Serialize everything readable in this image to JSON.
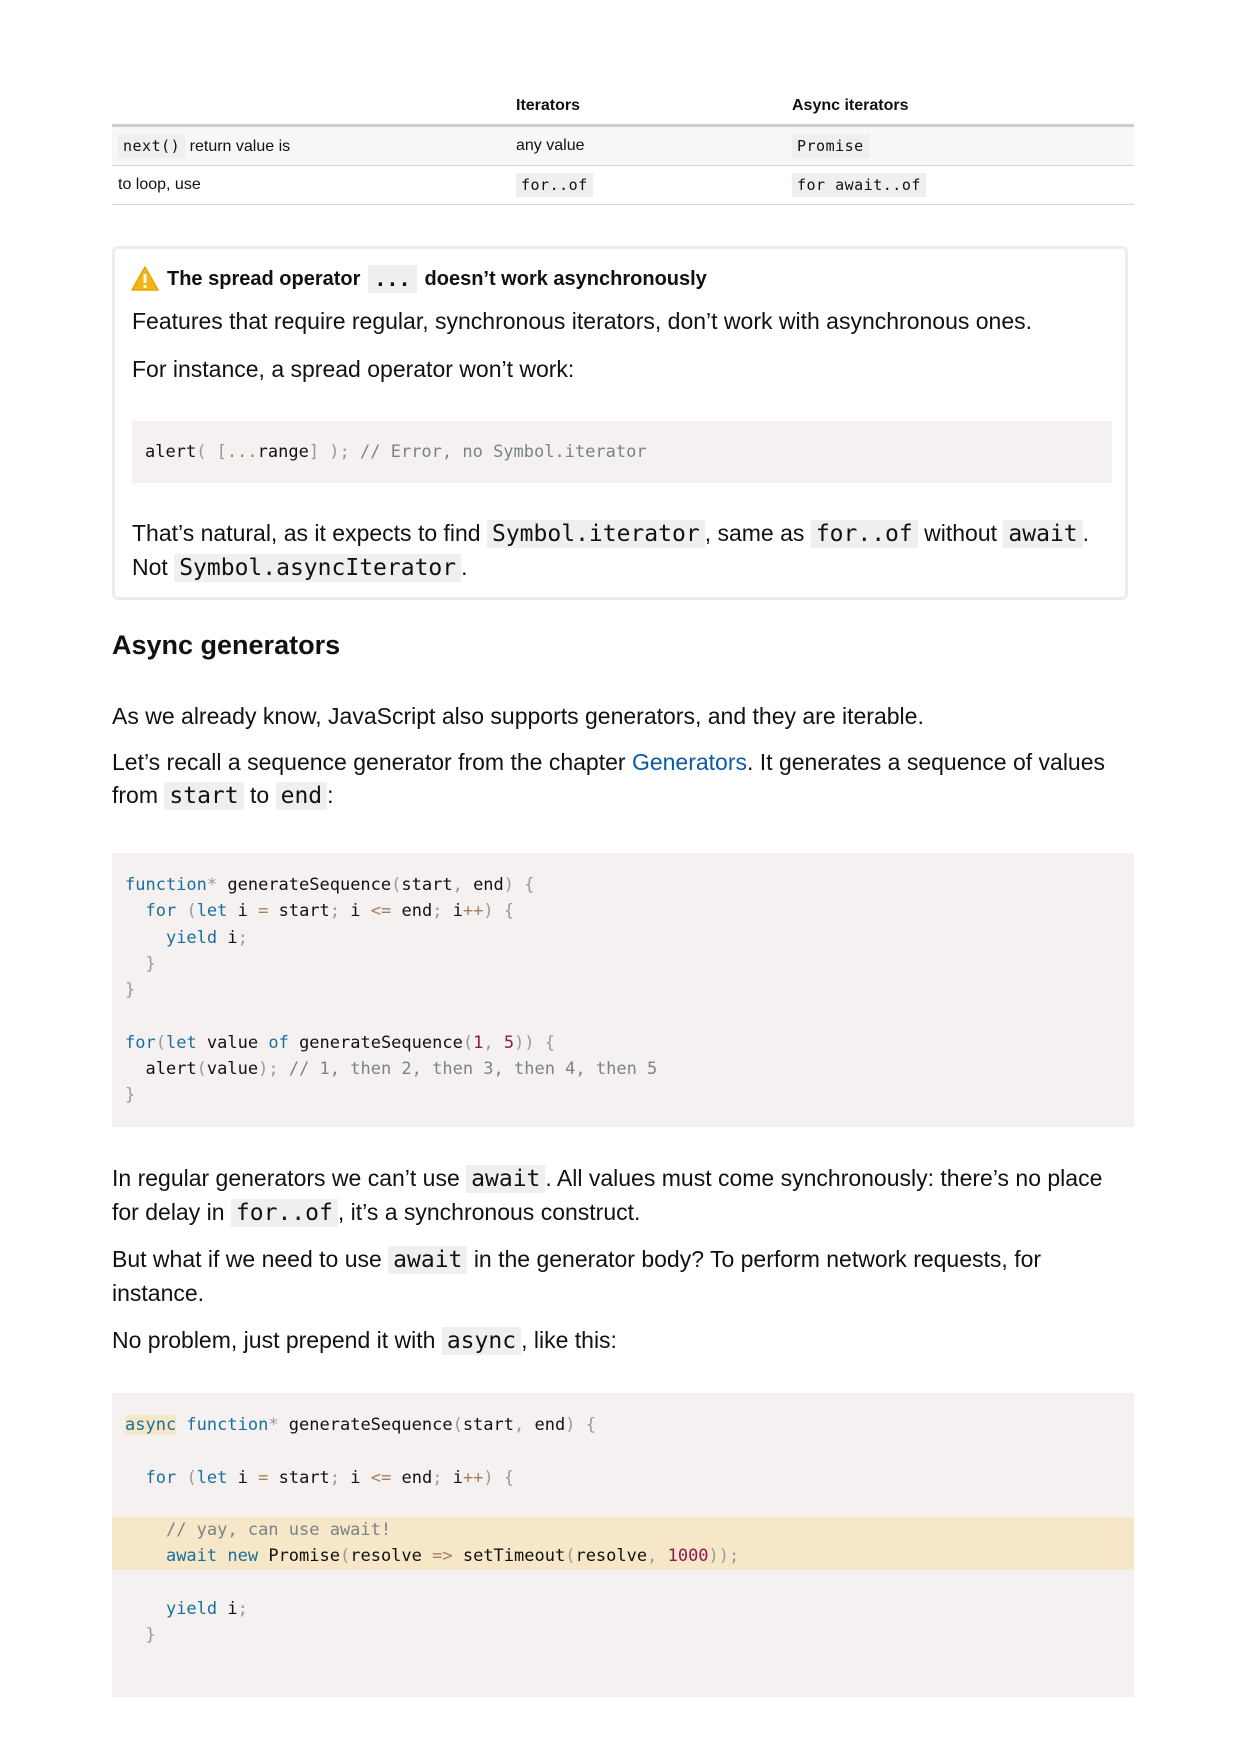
{
  "table": {
    "headers": [
      "",
      "Iterators",
      "Async iterators"
    ],
    "rows": [
      {
        "label_code": "next()",
        "label_text": "return value is",
        "iter": "any value",
        "iter_code": "",
        "async_code": "Promise"
      },
      {
        "label_code": "",
        "label_text": "to loop, use",
        "iter": "",
        "iter_code": "for..of",
        "async_code": "for await..of"
      }
    ]
  },
  "warning": {
    "title_before": "The spread operator",
    "title_code": "...",
    "title_after": "doesn’t work asynchronously",
    "p1": "Features that require regular, synchronous iterators, don’t work with asynchronous ones.",
    "p2": "For instance, a spread operator won’t work:",
    "code": {
      "fn": "alert",
      "p_open": "( [",
      "spread": "...",
      "arg": "range",
      "p_close": "] );",
      "comment": "// Error, no Symbol.iterator"
    },
    "p3": {
      "t1": "That’s natural, as it expects to find",
      "c1": "Symbol.iterator",
      "t2": ", same as",
      "c2": "for..of",
      "t3": "without",
      "c3": "await",
      "t4": ". Not",
      "c4": "Symbol.asyncIterator",
      "t5": "."
    }
  },
  "section_title": "Async generators",
  "paras": {
    "p1": "As we already know, JavaScript also supports generators, and they are iterable.",
    "p2": {
      "t1": "Let’s recall a sequence generator from the chapter",
      "link": "Generators",
      "t2": ". It generates a sequence of values from",
      "c1": "start",
      "t3": "to",
      "c2": "end",
      "t4": ":"
    },
    "p3": {
      "t1": "In regular generators we can’t use",
      "c1": "await",
      "t2": ". All values must come synchronously: there’s no place for delay in",
      "c2": "for..of",
      "t3": ", it’s a synchronous construct."
    },
    "p4": {
      "t1": "But what if we need to use",
      "c1": "await",
      "t2": "in the generator body? To perform network requests, for instance."
    },
    "p5": {
      "t1": "No problem, just prepend it with",
      "c1": "async",
      "t2": ", like this:"
    }
  },
  "code1": {
    "l1": {
      "kw": "function",
      "star": "*",
      "name": " generateSequence",
      "po": "(",
      "a1": "start",
      "comma": ",",
      "a2": " end",
      "pc": ")",
      "br": " {"
    },
    "l2": {
      "kw1": "for",
      "po": " (",
      "kw2": "let",
      "v": " i ",
      "eq": "=",
      "s": " start",
      "semi": ";",
      "i": " i ",
      "le": "<=",
      "e": " end",
      "semi2": ";",
      "ip": " i",
      "pp": "++",
      "pc": ")",
      "br": " {"
    },
    "l3": {
      "kw": "yield",
      "v": " i",
      "semi": ";"
    },
    "l4": "}",
    "l5": "}",
    "l7": {
      "kw1": "for",
      "po": "(",
      "kw2": "let",
      "v": " value ",
      "kw3": "of",
      "fn": " generateSequence",
      "po2": "(",
      "n1": "1",
      "comma": ",",
      "n2": " 5",
      "pc": "))",
      "br": " {"
    },
    "l8": {
      "fn": "alert",
      "po": "(",
      "v": "value",
      "pc": ");",
      "cm": " // 1, then 2, then 3, then 4, then 5"
    },
    "l9": "}"
  },
  "code2": {
    "l1": {
      "async": "async",
      "kw": " function",
      "star": "*",
      "name": " generateSequence",
      "po": "(",
      "a1": "start",
      "comma": ",",
      "a2": " end",
      "pc": ")",
      "br": " {"
    },
    "l3": {
      "kw1": "for",
      "po": " (",
      "kw2": "let",
      "v": " i ",
      "eq": "=",
      "s": " start",
      "semi": ";",
      "i": " i ",
      "le": "<=",
      "e": " end",
      "semi2": ";",
      "ip": " i",
      "pp": "++",
      "pc": ")",
      "br": " {"
    },
    "l5": "// yay, can use await!",
    "l6": {
      "kw1": "await",
      "kw2": " new",
      "cls": " Promise",
      "po": "(",
      "arg": "resolve ",
      "arrow": "=>",
      "fn": " setTimeout",
      "po2": "(",
      "a": "resolve",
      "comma": ",",
      "num": " 1000",
      "pc": "));"
    },
    "l8": {
      "kw": "yield",
      "v": " i",
      "semi": ";"
    },
    "l9": "}"
  },
  "colors": {
    "keyword": "#1a6f9c",
    "number": "#8b1a52",
    "comment": "#7b8288",
    "highlight": "#f5e7c7",
    "link": "#0a5aa7",
    "code_bg": "#f4f1f0"
  }
}
